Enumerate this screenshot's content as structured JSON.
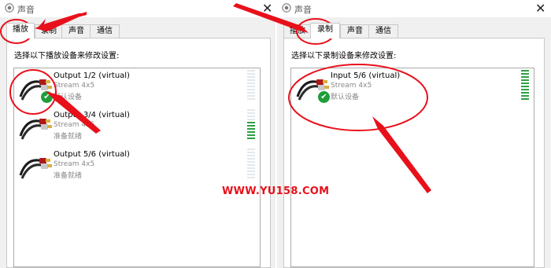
{
  "left_window": {
    "title": "声音",
    "close_glyph": "✕",
    "tabs": [
      "播放",
      "录制",
      "声音",
      "通信"
    ],
    "active_tab": 0,
    "instruction": "选择以下播放设备来修改设置:",
    "devices": [
      {
        "name": "Output 1/2 (virtual)",
        "sub": "Stream 4x5",
        "status": "默认设备",
        "default": true,
        "level": 0
      },
      {
        "name": "Output 3/4 (virtual)",
        "sub": "Stream 4x5",
        "status": "准备就绪",
        "default": false,
        "level": 0.6
      },
      {
        "name": "Output 5/6 (virtual)",
        "sub": "Stream 4x5",
        "status": "准备就绪",
        "default": false,
        "level": 0
      }
    ]
  },
  "right_window": {
    "title": "声音",
    "close_glyph": "✕",
    "tabs": [
      "播放",
      "录制",
      "声音",
      "通信"
    ],
    "active_tab": 1,
    "instruction": "选择以下录制设备来修改设置:",
    "devices": [
      {
        "name": "Input 5/6 (virtual)",
        "sub": "Stream 4x5",
        "status": "默认设备",
        "default": true,
        "level": 1
      }
    ]
  },
  "watermark": "WWW.YU158.COM",
  "icons": {
    "title": "speaker-icon",
    "device": "audio-cable-icon",
    "default_badge": "green-check-icon"
  },
  "colors": {
    "annotation": "#e8101a",
    "meter_on": "#2ea043",
    "meter_off": "#e3e8ec",
    "check": "#1e9e3a"
  }
}
